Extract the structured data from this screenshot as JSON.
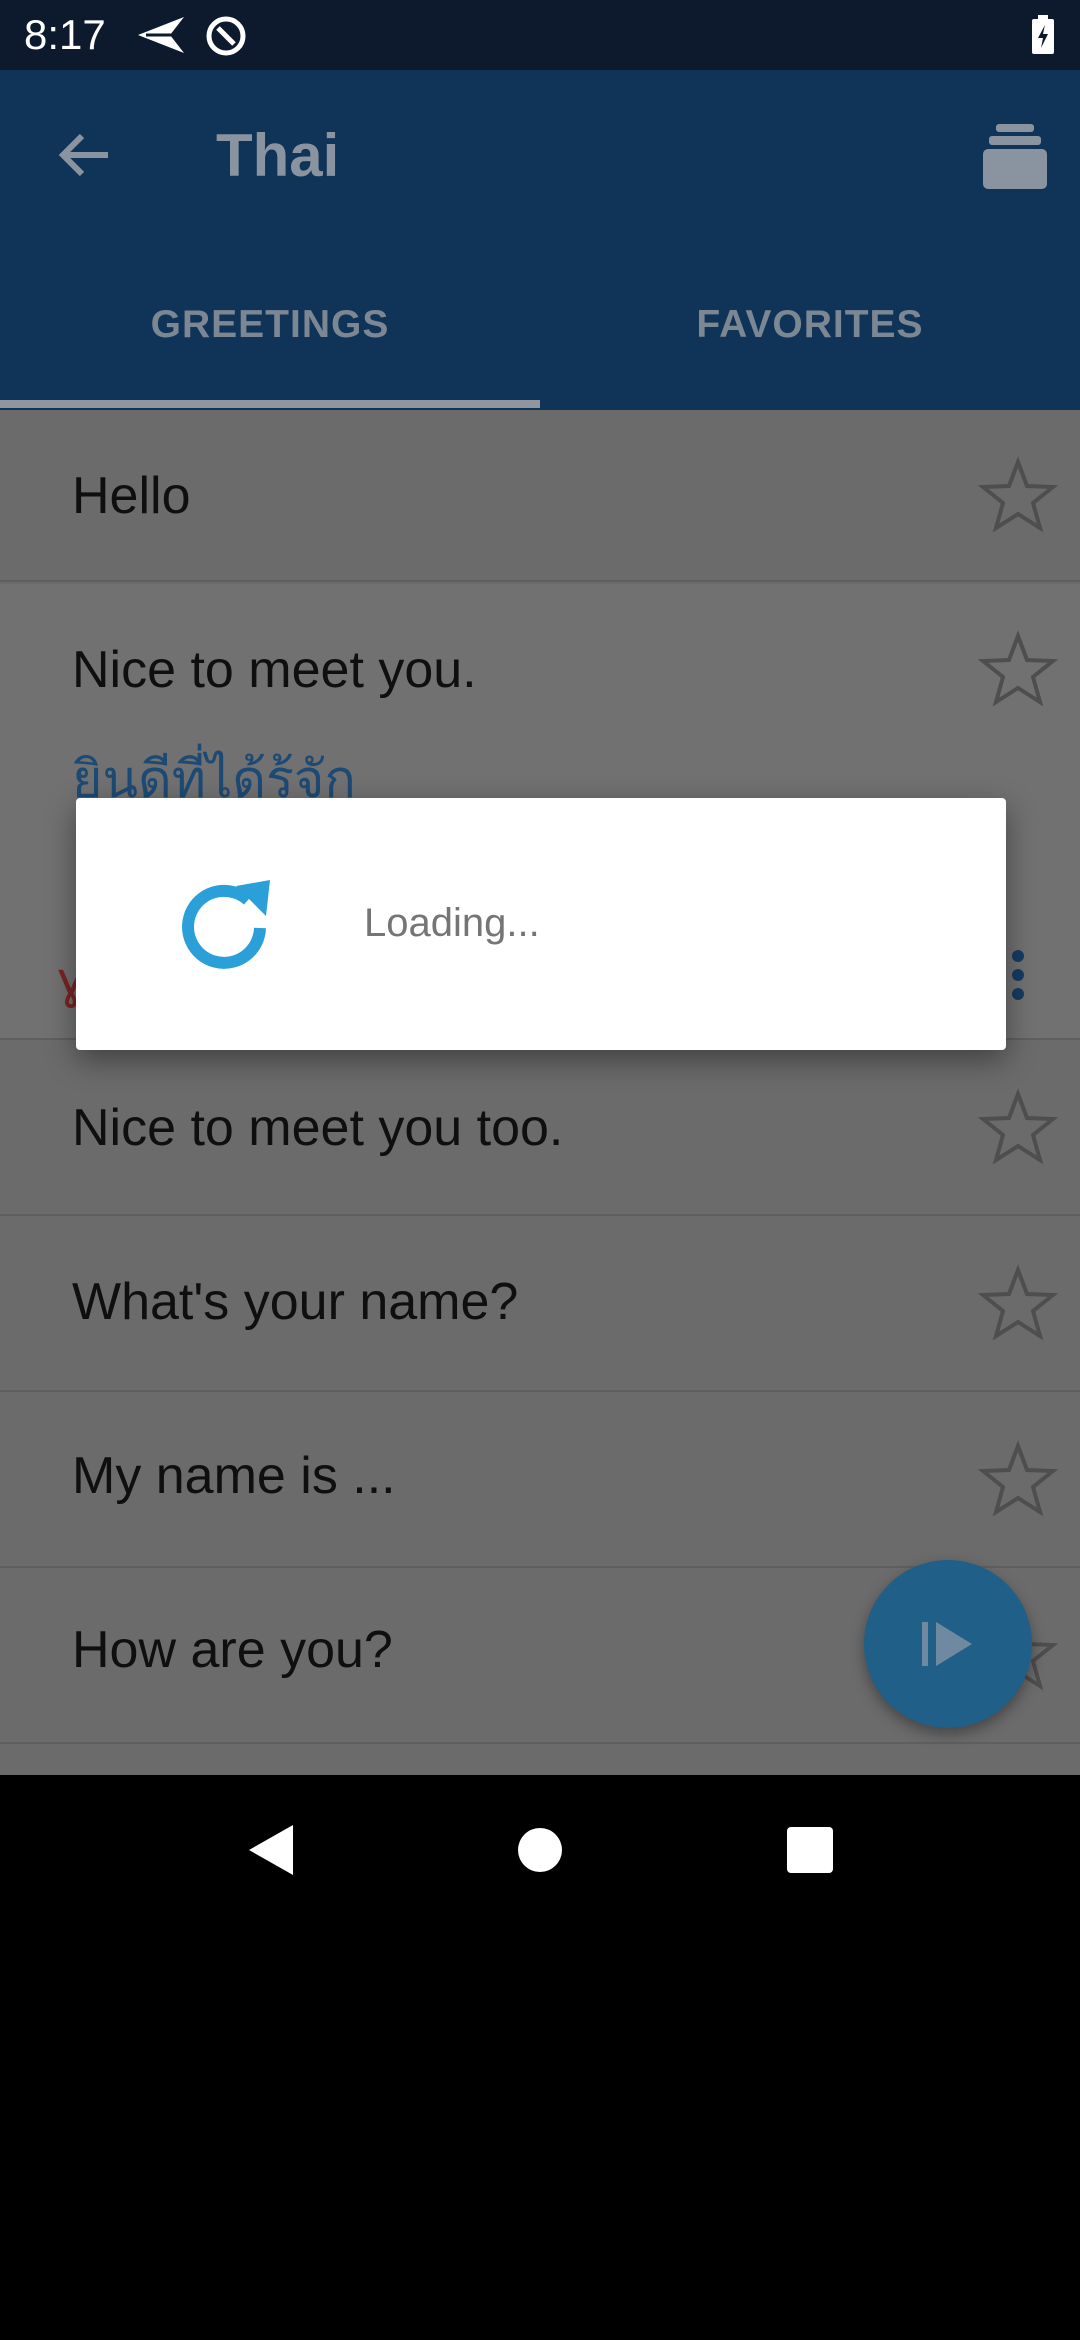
{
  "status_bar": {
    "time": "8:17",
    "icons": [
      "navigation-arrow-icon",
      "data-saver-icon",
      "battery-charging-icon"
    ]
  },
  "app_bar": {
    "title": "Thai",
    "back_icon": "back-arrow-icon",
    "overflow_icon": "stack-menu-icon"
  },
  "tabs": [
    {
      "label": "GREETINGS",
      "selected": true
    },
    {
      "label": "FAVORITES",
      "selected": false
    }
  ],
  "phrases": [
    {
      "text": "Hello",
      "favorite": false
    },
    {
      "text": "Nice to meet you.",
      "favorite": false,
      "translation": "ยินดีที่ได้รู้จัก",
      "expanded": true
    },
    {
      "text": "Nice to meet you too.",
      "favorite": false
    },
    {
      "text": "What's your name?",
      "favorite": false
    },
    {
      "text": "My name is ...",
      "favorite": false
    },
    {
      "text": "How are you?",
      "favorite": false
    }
  ],
  "dialog": {
    "message": "Loading...",
    "icon": "refresh-icon"
  },
  "fab": {
    "icon": "play-icon"
  },
  "colors": {
    "app_bar": "#103358",
    "dialog_icon": "#2a9fd8",
    "overlay_list": "#6b6b6b",
    "fab": "#1f5f88"
  },
  "nav_bar": {
    "icons": [
      "nav-back-icon",
      "nav-home-icon",
      "nav-recents-icon"
    ]
  }
}
